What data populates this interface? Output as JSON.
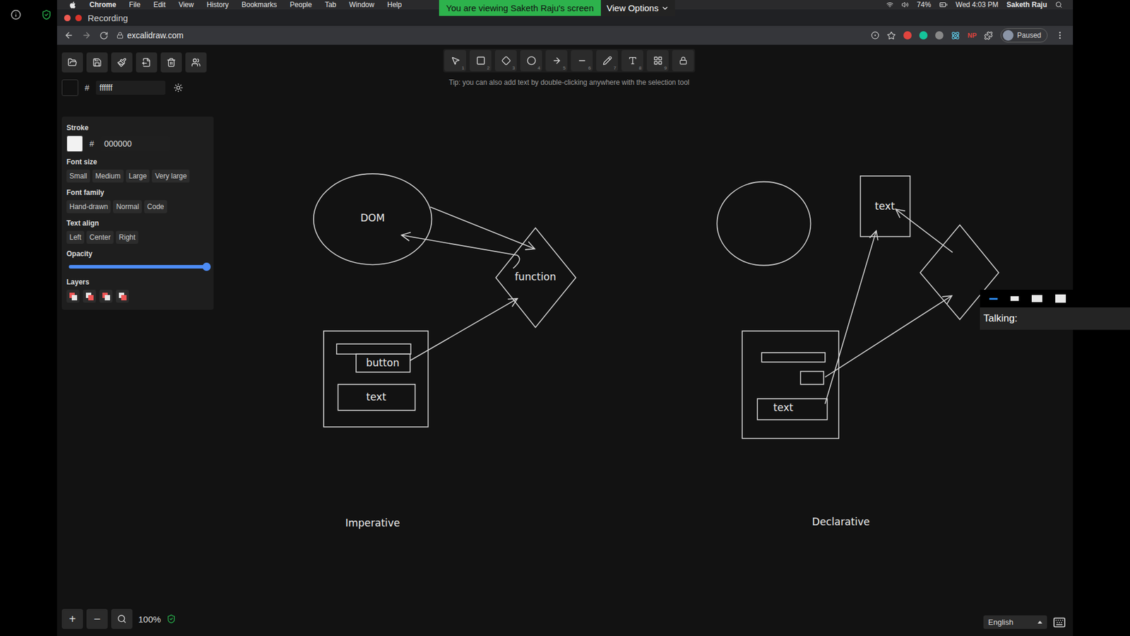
{
  "window": {
    "recording": "Recording"
  },
  "menu_bar": {
    "items": [
      "Chrome",
      "File",
      "Edit",
      "View",
      "History",
      "Bookmarks",
      "People",
      "Tab",
      "Window",
      "Help"
    ],
    "battery": "74%",
    "clock": "Wed 4:03 PM",
    "user": "Saketh Raju"
  },
  "share_banner": {
    "text": "You are viewing Saketh Raju's screen",
    "button": "View Options"
  },
  "address_bar": {
    "url": "excalidraw.com",
    "extension_badge": "NP",
    "profile": "Paused"
  },
  "excalidraw": {
    "background": {
      "hash": "#",
      "value": "ffffff"
    },
    "properties": {
      "stroke": {
        "label": "Stroke",
        "hash": "#",
        "value": "000000"
      },
      "font_size": {
        "label": "Font size",
        "options": [
          "Small",
          "Medium",
          "Large",
          "Very large"
        ]
      },
      "font_family": {
        "label": "Font family",
        "options": [
          "Hand-drawn",
          "Normal",
          "Code"
        ]
      },
      "text_align": {
        "label": "Text align",
        "options": [
          "Left",
          "Center",
          "Right"
        ]
      },
      "opacity": {
        "label": "Opacity",
        "level": 1
      },
      "layers": {
        "label": "Layers"
      }
    },
    "tools": [
      {
        "shortcut": "1"
      },
      {
        "shortcut": "2"
      },
      {
        "shortcut": "3"
      },
      {
        "shortcut": "4"
      },
      {
        "shortcut": "5"
      },
      {
        "shortcut": "6"
      },
      {
        "shortcut": "7"
      },
      {
        "shortcut": "8"
      },
      {
        "shortcut": "9"
      }
    ],
    "tip": "Tip: you can also add text by double-clicking anywhere with the selection tool",
    "zoom": {
      "in": "+",
      "out": "−",
      "value": "100%"
    },
    "language": "English"
  },
  "diagram": {
    "imperative": {
      "ellipse_label": "DOM",
      "diamond_label": "function",
      "button_label": "button",
      "text_label": "text",
      "caption": "Imperative"
    },
    "declarative": {
      "box_label": "text",
      "text_label": "text",
      "caption": "Declarative"
    }
  },
  "zoom_panel": {
    "views": [
      {
        "selected": true
      },
      {
        "selected": false
      },
      {
        "selected": false
      },
      {
        "selected": false
      }
    ],
    "status": "Talking:"
  }
}
